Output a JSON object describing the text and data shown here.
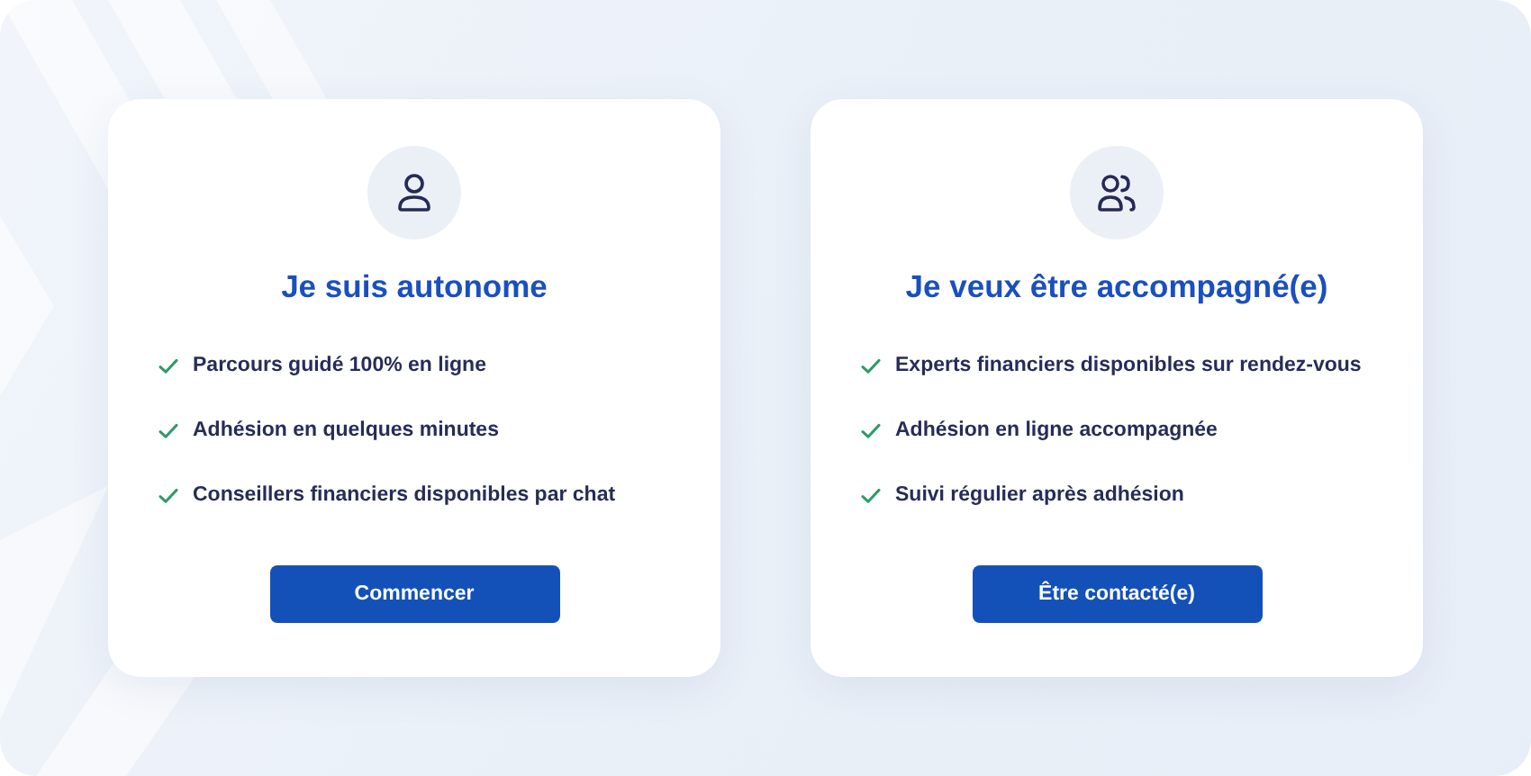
{
  "cards": [
    {
      "kind": "solo",
      "title": "Je suis autonome",
      "features": [
        "Parcours guidé 100% en ligne",
        "Adhésion en quelques minutes",
        "Conseillers financiers disponibles par chat"
      ],
      "button": "Commencer"
    },
    {
      "kind": "assisted",
      "title": "Je veux être accompagné(e)",
      "features": [
        "Experts financiers disponibles sur rendez-vous",
        "Adhésion en ligne accompagnée",
        "Suivi régulier après adhésion"
      ],
      "button": "Être contacté(e)"
    }
  ]
}
